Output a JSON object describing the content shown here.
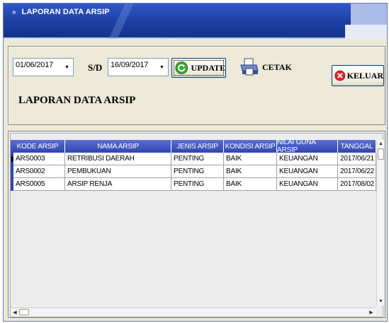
{
  "window": {
    "title": "LAPORAN DATA ARSIP",
    "title_chevron": "»"
  },
  "filters": {
    "start_date": "01/06/2017",
    "separator": "S/D",
    "end_date": "16/09/2017",
    "dropdown_glyph": "▼"
  },
  "buttons": {
    "update": "UPDATE",
    "cetak": "CETAK",
    "keluar": "KELUAR"
  },
  "report_heading": "LAPORAN DATA ARSIP",
  "table": {
    "columns": [
      "KODE ARSIP",
      "NAMA ARSIP",
      "JENIS ARSIP",
      "KONDISI ARSIP",
      "NILAI GUNA ARSIP",
      "TANGGAL"
    ],
    "rows": [
      [
        "ARS0003",
        "RETRIBUSI DAERAH",
        "PENTING",
        "BAIK",
        "KEUANGAN",
        "2017/06/21"
      ],
      [
        "ARS0002",
        "PEMBUKUAN",
        "PENTING",
        "BAIK",
        "KEUANGAN",
        "2017/06/22"
      ],
      [
        "ARS0005",
        "ARSIP RENJA",
        "PENTING",
        "BAIK",
        "KEUANGAN",
        "2017/08/02"
      ]
    ]
  },
  "colors": {
    "title_blue": "#1c3fa3",
    "header_blue": "#2f45b5",
    "keluar_red": "#d62b2b",
    "update_green": "#3aa832"
  }
}
